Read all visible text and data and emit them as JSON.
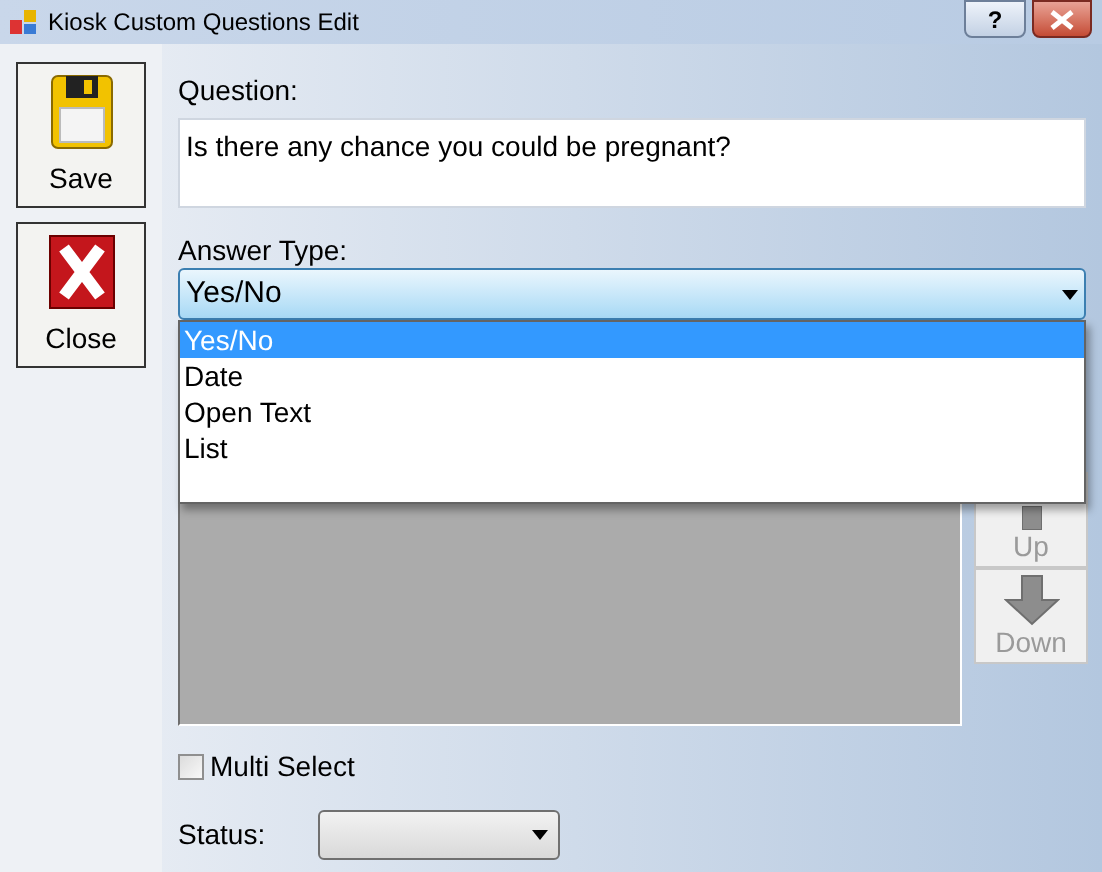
{
  "window": {
    "title": "Kiosk Custom Questions Edit",
    "help_glyph": "?"
  },
  "toolbar": [
    {
      "kind": "save",
      "label": "Save"
    },
    {
      "kind": "close",
      "label": "Close"
    }
  ],
  "question": {
    "label": "Question:",
    "value": "Is there any chance you could be pregnant?"
  },
  "answer_type": {
    "label": "Answer Type:",
    "value": "Yes/No",
    "expanded": true,
    "options": [
      {
        "label": "Yes/No",
        "selected": true
      },
      {
        "label": "Date",
        "selected": false
      },
      {
        "label": "Open Text",
        "selected": false
      },
      {
        "label": "List",
        "selected": false
      }
    ]
  },
  "order_buttons": [
    {
      "kind": "up",
      "label": "Up",
      "disabled": true
    },
    {
      "kind": "down",
      "label": "Down",
      "disabled": true
    }
  ],
  "multi_select": {
    "label": "Multi Select",
    "checked": false
  },
  "status": {
    "label": "Status:"
  }
}
